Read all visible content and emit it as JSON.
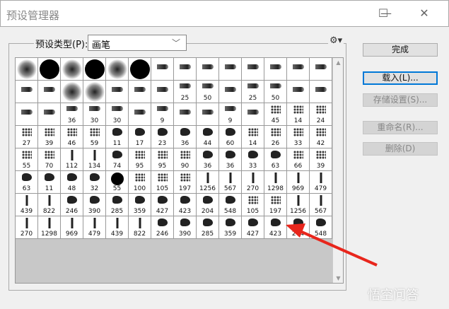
{
  "window": {
    "title": "预设管理器",
    "minimize": "—",
    "maximize": "☐",
    "close": "✕"
  },
  "preset_type": {
    "label": "预设类型(P):",
    "value": "画笔",
    "gear": "⚙▾"
  },
  "buttons": {
    "done": "完成",
    "load": "载入(L)...",
    "save": "存储设置(S)...",
    "rename": "重命名(R)...",
    "delete": "删除(D)"
  },
  "watermark": "悟空问答",
  "accent": "#0078d7",
  "arrow_color": "#e8261c",
  "rows": [
    [
      [
        "soft",
        ""
      ],
      [
        "hard",
        ""
      ],
      [
        "soft",
        ""
      ],
      [
        "hard",
        ""
      ],
      [
        "soft",
        ""
      ],
      [
        "hard",
        ""
      ],
      [
        "tip",
        ""
      ],
      [
        "tip",
        ""
      ],
      [
        "tip",
        ""
      ],
      [
        "tip",
        ""
      ],
      [
        "tip",
        ""
      ],
      [
        "tip",
        ""
      ],
      [
        "tip",
        ""
      ],
      [
        "tip",
        ""
      ]
    ],
    [
      [
        "tip",
        ""
      ],
      [
        "tip",
        ""
      ],
      [
        "soft",
        ""
      ],
      [
        "soft",
        ""
      ],
      [
        "tip",
        ""
      ],
      [
        "tip",
        ""
      ],
      [
        "tip",
        ""
      ],
      [
        "tip",
        "25"
      ],
      [
        "tip",
        "50"
      ],
      [
        "tip",
        ""
      ],
      [
        "tip",
        "25"
      ],
      [
        "tip",
        "50"
      ],
      [
        "tip",
        ""
      ],
      [
        "tip",
        ""
      ]
    ],
    [
      [
        "tip",
        ""
      ],
      [
        "tip",
        ""
      ],
      [
        "tip",
        "36"
      ],
      [
        "tip",
        "30"
      ],
      [
        "tip",
        "30"
      ],
      [
        "tip",
        ""
      ],
      [
        "tip",
        "9"
      ],
      [
        "tip",
        ""
      ],
      [
        "tip",
        ""
      ],
      [
        "tip",
        "9"
      ],
      [
        "tip",
        ""
      ],
      [
        "scat",
        "45"
      ],
      [
        "scat",
        "14"
      ],
      [
        "scat",
        "24"
      ]
    ],
    [
      [
        "scat",
        "27"
      ],
      [
        "scat",
        "39"
      ],
      [
        "scat",
        "46"
      ],
      [
        "scat",
        "59"
      ],
      [
        "blob",
        "11"
      ],
      [
        "blob",
        "17"
      ],
      [
        "blob",
        "23"
      ],
      [
        "blob",
        "36"
      ],
      [
        "blob",
        "44"
      ],
      [
        "blob",
        "60"
      ],
      [
        "scat",
        "14"
      ],
      [
        "scat",
        "26"
      ],
      [
        "scat",
        "33"
      ],
      [
        "scat",
        "42"
      ]
    ],
    [
      [
        "scat",
        "55"
      ],
      [
        "scat",
        "70"
      ],
      [
        "stroke",
        "112"
      ],
      [
        "stroke",
        "134"
      ],
      [
        "blob",
        "74"
      ],
      [
        "scat",
        "95"
      ],
      [
        "scat",
        "95"
      ],
      [
        "scat",
        "90"
      ],
      [
        "blob",
        "36"
      ],
      [
        "blob",
        "36"
      ],
      [
        "blob",
        "33"
      ],
      [
        "blob",
        "63"
      ],
      [
        "scat",
        "66"
      ],
      [
        "scat",
        "39"
      ]
    ],
    [
      [
        "blob",
        "63"
      ],
      [
        "blob",
        "11"
      ],
      [
        "blob",
        "48"
      ],
      [
        "blob",
        "32"
      ],
      [
        "hardsm",
        "55"
      ],
      [
        "scat",
        "100"
      ],
      [
        "scat",
        "105"
      ],
      [
        "scat",
        "197"
      ],
      [
        "stroke",
        "1256"
      ],
      [
        "stroke",
        "567"
      ],
      [
        "stroke",
        "270"
      ],
      [
        "stroke",
        "1298"
      ],
      [
        "stroke",
        "969"
      ],
      [
        "stroke",
        "479"
      ]
    ],
    [
      [
        "stroke",
        "439"
      ],
      [
        "stroke",
        "822"
      ],
      [
        "blob",
        "246"
      ],
      [
        "blob",
        "390"
      ],
      [
        "blob",
        "285"
      ],
      [
        "blob",
        "359"
      ],
      [
        "blob",
        "427"
      ],
      [
        "blob",
        "423"
      ],
      [
        "blob",
        "204"
      ],
      [
        "blob",
        "548"
      ],
      [
        "scat",
        "105"
      ],
      [
        "scat",
        "197"
      ],
      [
        "stroke",
        "1256"
      ],
      [
        "stroke",
        "567"
      ]
    ],
    [
      [
        "stroke",
        "270"
      ],
      [
        "stroke",
        "1298"
      ],
      [
        "stroke",
        "969"
      ],
      [
        "stroke",
        "479"
      ],
      [
        "stroke",
        "439"
      ],
      [
        "stroke",
        "822"
      ],
      [
        "blob",
        "246"
      ],
      [
        "blob",
        "390"
      ],
      [
        "blob",
        "285"
      ],
      [
        "blob",
        "359"
      ],
      [
        "blob",
        "427"
      ],
      [
        "blob",
        "423"
      ],
      [
        "blob",
        "204"
      ],
      [
        "blob",
        "548"
      ]
    ]
  ]
}
